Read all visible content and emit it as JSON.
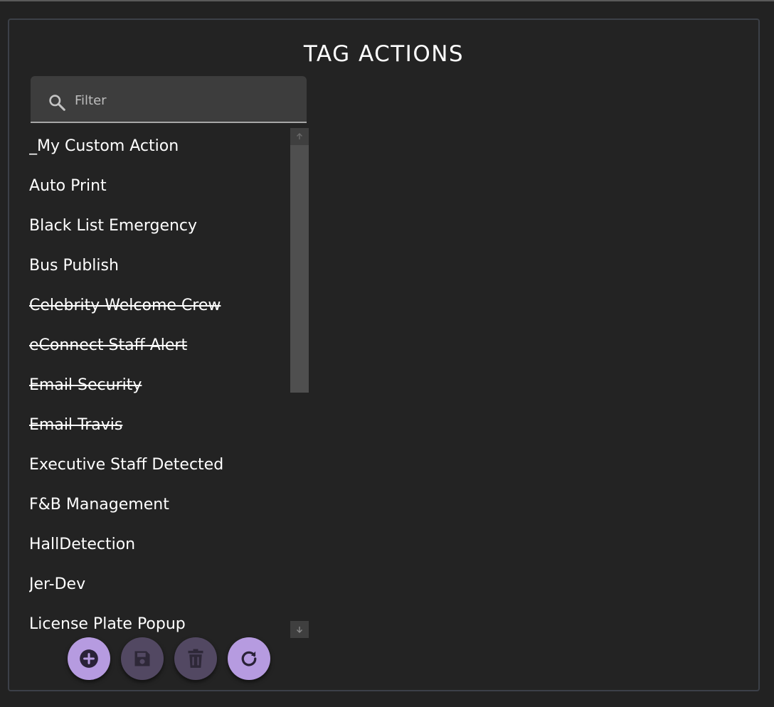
{
  "page": {
    "title": "TAG ACTIONS"
  },
  "filter": {
    "placeholder": "Filter",
    "value": ""
  },
  "actions": [
    {
      "label": "_My Custom Action",
      "disabled": false
    },
    {
      "label": "Auto Print",
      "disabled": false
    },
    {
      "label": "Black List Emergency",
      "disabled": false
    },
    {
      "label": "Bus Publish",
      "disabled": false
    },
    {
      "label": "Celebrity Welcome Crew",
      "disabled": true
    },
    {
      "label": "eConnect Staff Alert",
      "disabled": true
    },
    {
      "label": "Email Security",
      "disabled": true
    },
    {
      "label": "Email Travis",
      "disabled": true
    },
    {
      "label": "Executive Staff Detected",
      "disabled": false
    },
    {
      "label": "F&B Management",
      "disabled": false
    },
    {
      "label": "HallDetection",
      "disabled": false
    },
    {
      "label": "Jer-Dev",
      "disabled": false
    },
    {
      "label": "License Plate Popup",
      "disabled": false
    }
  ],
  "scroll": {
    "position_fraction": 0
  },
  "toolbar": {
    "add": {
      "icon": "plus-circle-icon",
      "enabled": true
    },
    "save": {
      "icon": "floppy-disk-icon",
      "enabled": false
    },
    "delete": {
      "icon": "trash-icon",
      "enabled": false
    },
    "refresh": {
      "icon": "refresh-icon",
      "enabled": true
    }
  },
  "colors": {
    "background": "#222222",
    "panel_border": "#3c4048",
    "accent": "#b69be0",
    "accent_disabled": "#524862",
    "icon_dark": "#2a2238",
    "text": "#ffffff"
  }
}
